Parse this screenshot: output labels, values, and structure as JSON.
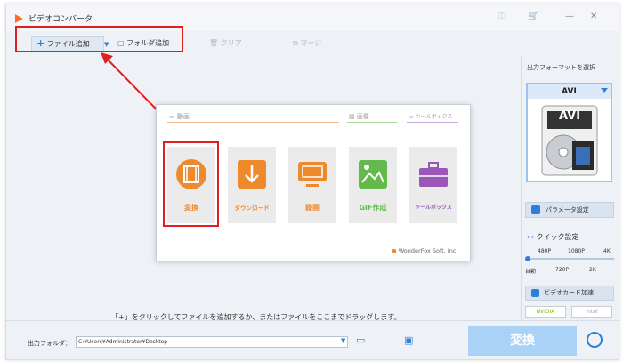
{
  "app": {
    "title": "ビデオコンバータ"
  },
  "toolbar": {
    "add_file": "ファイル追加",
    "add_folder": "フォルダ追加",
    "clear": "クリア",
    "merge": "マージ"
  },
  "main": {
    "hint": "「+」をクリックしてファイルを追加するか、またはファイルをここまでドラッグします。"
  },
  "popup": {
    "categories": {
      "video": "動画",
      "image": "画像",
      "toolbox": "ツールボックス"
    },
    "tiles": [
      {
        "label": "変換",
        "color": "#ef8a2c"
      },
      {
        "label": "ダウンロード",
        "color": "#ef8a2c"
      },
      {
        "label": "録画",
        "color": "#ef8a2c"
      },
      {
        "label": "GIF作成",
        "color": "#63b94b"
      },
      {
        "label": "ツールボックス",
        "color": "#9a57b8"
      }
    ],
    "brand": "WonderFox Soft, Inc."
  },
  "sidebar": {
    "title": "出力フォーマットを選択",
    "format": "AVI",
    "format_badge": "AVI",
    "param_button": "パラメータ設定",
    "quick_setting": "クイック設定",
    "quality_top": [
      "480P",
      "1080P",
      "4K"
    ],
    "quality_bottom": [
      "自動",
      "720P",
      "2K"
    ],
    "gpu": "ビデオカード加速",
    "nvidia": "NVIDIA",
    "intel": "Intel"
  },
  "bottom": {
    "output_label": "出力フォルダ：",
    "output_path": "C:¥Users¥Administrator¥Desktop",
    "convert_button": "変換"
  },
  "colors": {
    "accent": "#2f7fd8",
    "highlight": "#e02020",
    "convert": "#a9d2f6"
  }
}
